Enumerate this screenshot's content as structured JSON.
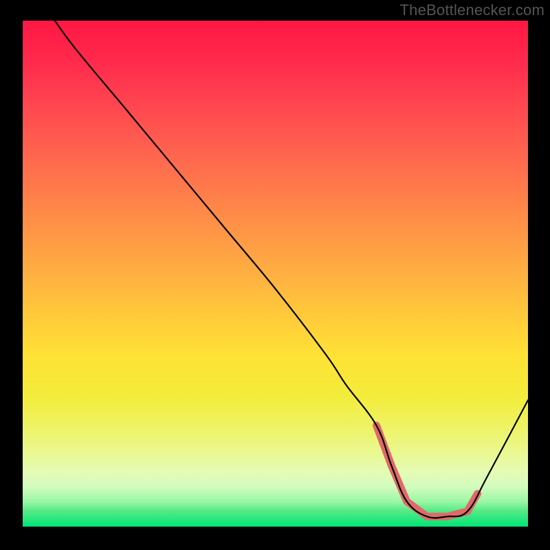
{
  "attribution": "TheBottlenecker.com",
  "chart_data": {
    "type": "line",
    "title": "",
    "xlabel": "",
    "ylabel": "",
    "ylim": [
      0,
      100
    ],
    "xlim": [
      0,
      100
    ],
    "x": [
      5,
      10,
      20,
      30,
      40,
      50,
      60,
      64,
      70,
      73,
      76,
      80,
      84,
      88,
      92,
      100
    ],
    "values": [
      102,
      95,
      83,
      71,
      59,
      47,
      34,
      28,
      20,
      12,
      5,
      2,
      2,
      3,
      10,
      25
    ],
    "highlight_start_x": 70,
    "highlight_end_x": 90,
    "highlight_color": "#E06A6A",
    "line_color": "#000000"
  }
}
